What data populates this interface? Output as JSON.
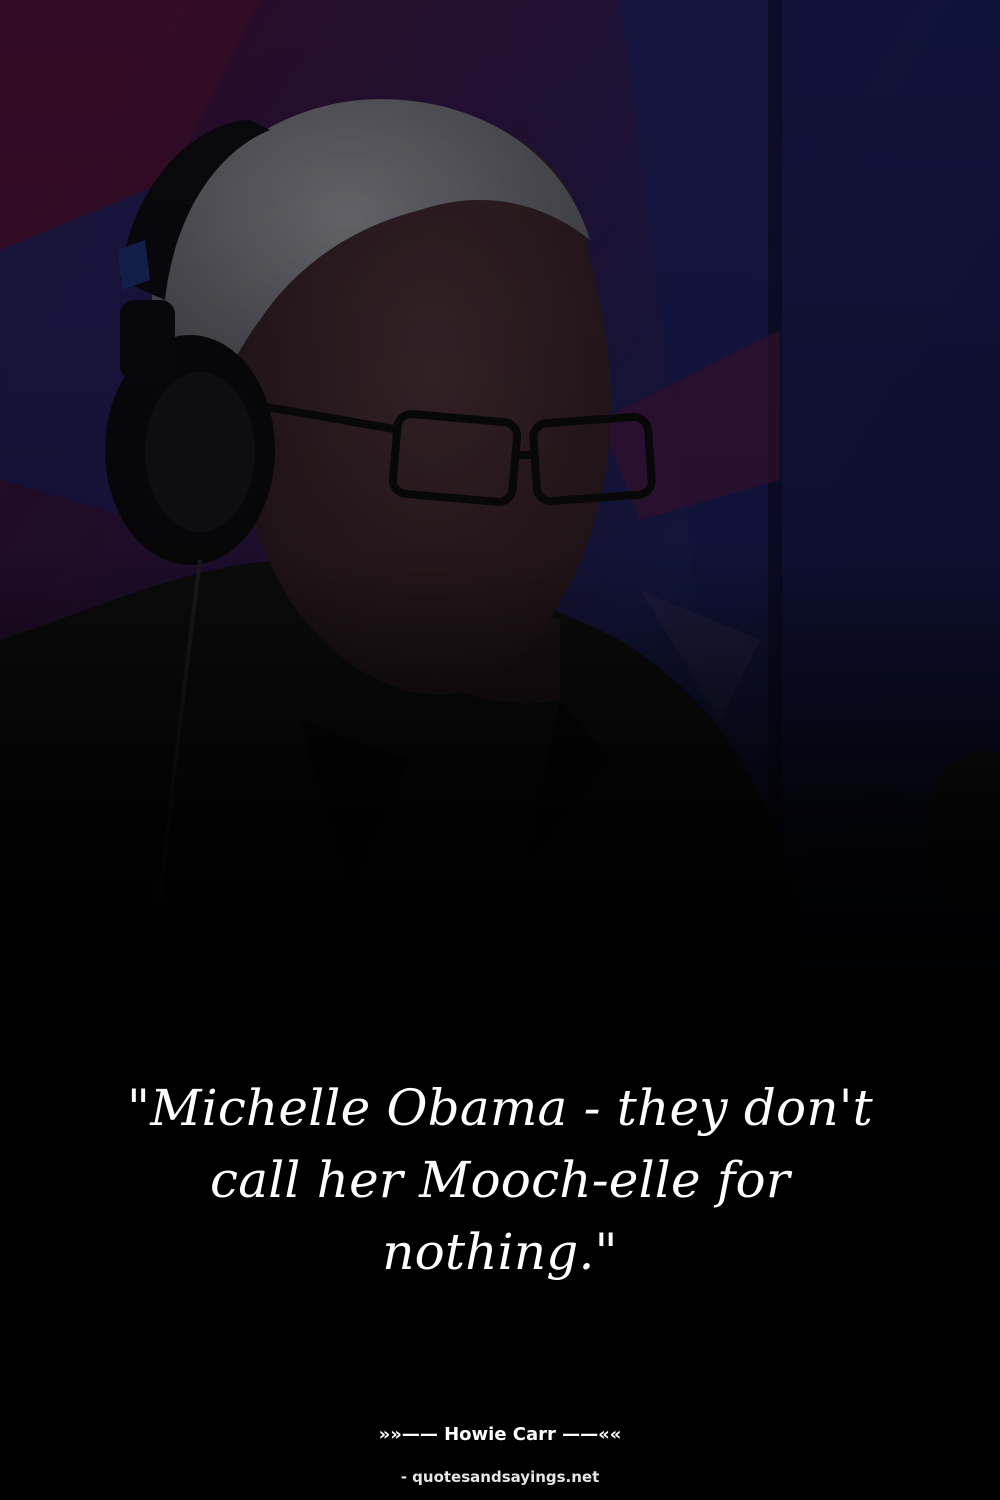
{
  "quote": {
    "text": "\"Michelle Obama - they don't call her Mooch-elle for nothing.\""
  },
  "attribution": {
    "author_line": "»»—— Howie Carr ——««"
  },
  "source": {
    "site_line": "- quotesandsayings.net"
  },
  "photo": {
    "subject": "man-with-headphones-and-glasses",
    "colors": {
      "background_red": "#3a0f2e",
      "background_blue": "#1a1f55",
      "fade": "#000000",
      "text": "#ffffff"
    }
  }
}
